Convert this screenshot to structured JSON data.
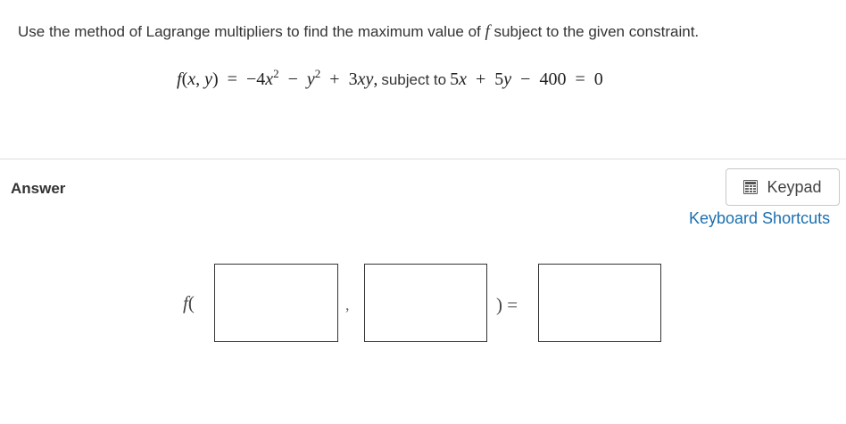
{
  "question": {
    "text_before": "Use the method of Lagrange multipliers to find the maximum value of ",
    "var": "f",
    "text_after": " subject to the given constraint."
  },
  "equation": {
    "function": "f(x, y) = −4x² − y² + 3xy,",
    "subject_to": "subject to",
    "constraint": "5x + 5y − 400 = 0"
  },
  "answer": {
    "label": "Answer",
    "keypad_label": "Keypad",
    "shortcuts_label": "Keyboard Shortcuts",
    "func_open": "f(",
    "comma": ",",
    "close_equals": ") =",
    "x_value": "",
    "y_value": "",
    "f_value": ""
  }
}
